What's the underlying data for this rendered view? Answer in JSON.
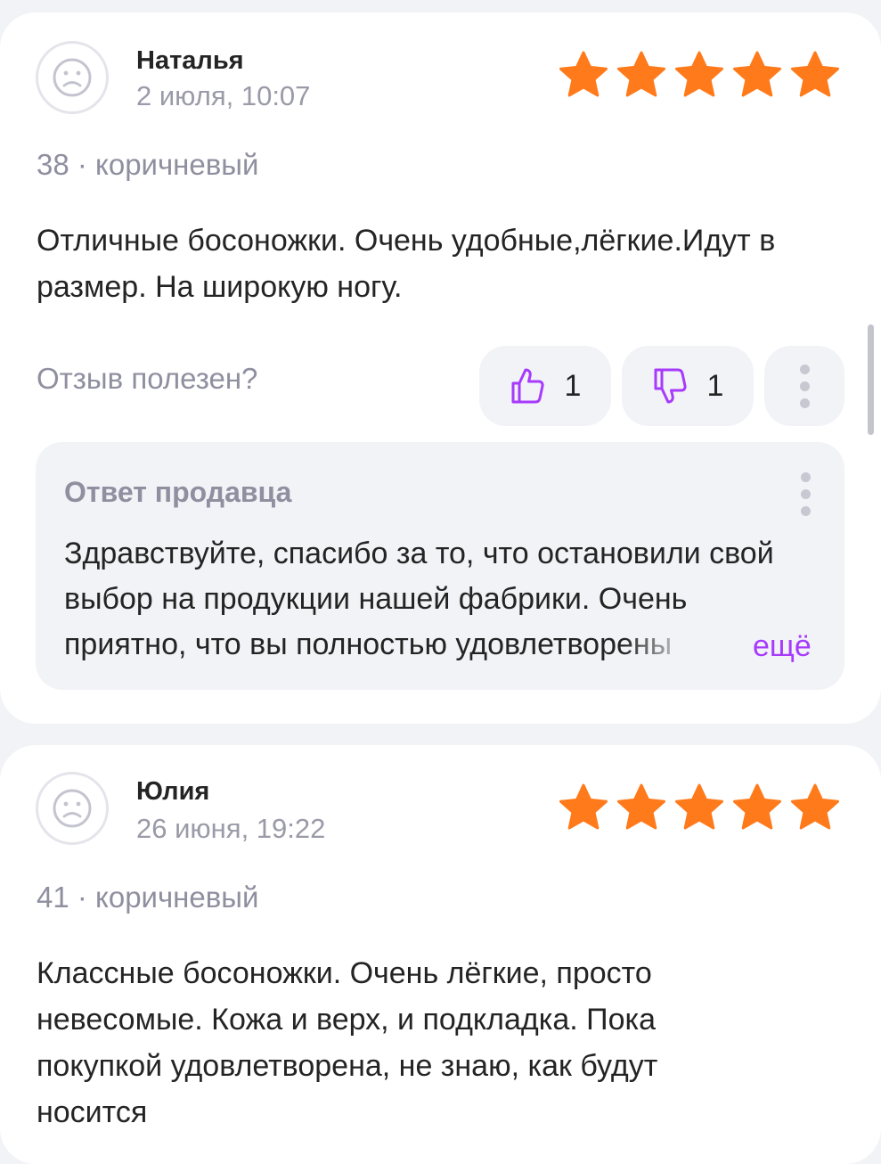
{
  "colors": {
    "star": "#ff7a1a",
    "accent": "#a73afd",
    "muted_text": "#8f8fa0",
    "panel": "#f2f3f7"
  },
  "reviews": [
    {
      "author": "Наталья",
      "date": "2 июля, 10:07",
      "rating": 5,
      "variant": "38 · коричневый",
      "text": "Отличные босоножки. Очень удобные,лёгкие.Идут в размер. На широкую ногу.",
      "helpful_question": "Отзыв полезен?",
      "likes": "1",
      "dislikes": "1",
      "seller_reply": {
        "title": "Ответ продавца",
        "text": "Здравствуйте, спасибо за то, что остановили свой выбор на продукции нашей фабрики. Очень приятно, что вы полностью удовлетворены",
        "more_label": "ещё"
      }
    },
    {
      "author": "Юлия",
      "date": "26 июня, 19:22",
      "rating": 5,
      "variant": "41 · коричневый",
      "text": "Классные босоножки. Очень лёгкие, просто невесомые. Кожа и верх, и подкладка. Пока покупкой удовлетворена, не знаю, как будут носится"
    }
  ],
  "icons": {
    "avatar": "sad-face-icon",
    "like": "thumbs-up-icon",
    "dislike": "thumbs-down-icon",
    "more": "vertical-dots-icon",
    "star": "star-icon"
  }
}
